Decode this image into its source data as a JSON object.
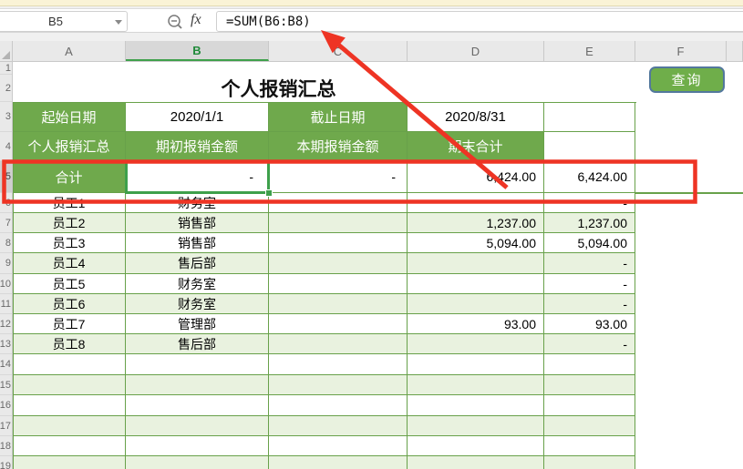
{
  "formula_bar": {
    "name_box": "B5",
    "fx_label": "fx",
    "formula": "=SUM(B6:B8)"
  },
  "column_headers": [
    "A",
    "B",
    "C",
    "D",
    "E",
    "F"
  ],
  "row_numbers": [
    "1",
    "2",
    "3",
    "4",
    "5",
    "6",
    "7",
    "8",
    "9",
    "10",
    "11",
    "12",
    "13",
    "14",
    "15",
    "16",
    "17",
    "18",
    "19"
  ],
  "sheet": {
    "title": "个人报销汇总",
    "query_button_label": "查询",
    "period": {
      "start_label": "起始日期",
      "start_date": "2020/1/1",
      "end_label": "截止日期",
      "end_date": "2020/8/31"
    },
    "table_headers": {
      "a": "个人报销汇总",
      "b": "期初报销金额",
      "c": "本期报销金额",
      "d": "期末合计"
    },
    "total_row": {
      "label": "合计",
      "begin": "-",
      "current": "-",
      "end_total": "6,424.00",
      "e_total": "6,424.00"
    },
    "employees": [
      {
        "name": "员工1",
        "dept": "财务室",
        "d": "",
        "e": "-"
      },
      {
        "name": "员工2",
        "dept": "销售部",
        "d": "1,237.00",
        "e": "1,237.00"
      },
      {
        "name": "员工3",
        "dept": "销售部",
        "d": "5,094.00",
        "e": "5,094.00"
      },
      {
        "name": "员工4",
        "dept": "售后部",
        "d": "",
        "e": "-"
      },
      {
        "name": "员工5",
        "dept": "财务室",
        "d": "",
        "e": "-"
      },
      {
        "name": "员工6",
        "dept": "财务室",
        "d": "",
        "e": "-"
      },
      {
        "name": "员工7",
        "dept": "管理部",
        "d": "93.00",
        "e": "93.00"
      },
      {
        "name": "员工8",
        "dept": "售后部",
        "d": "",
        "e": "-"
      }
    ]
  },
  "colors": {
    "header_green": "#6fa94c",
    "border_green": "#68a14a",
    "alt_row_green": "#e9f2df",
    "annotation_red": "#ee3424",
    "selection_green": "#3ea04b",
    "button_green": "#6fae4a",
    "button_border": "#53789d"
  }
}
